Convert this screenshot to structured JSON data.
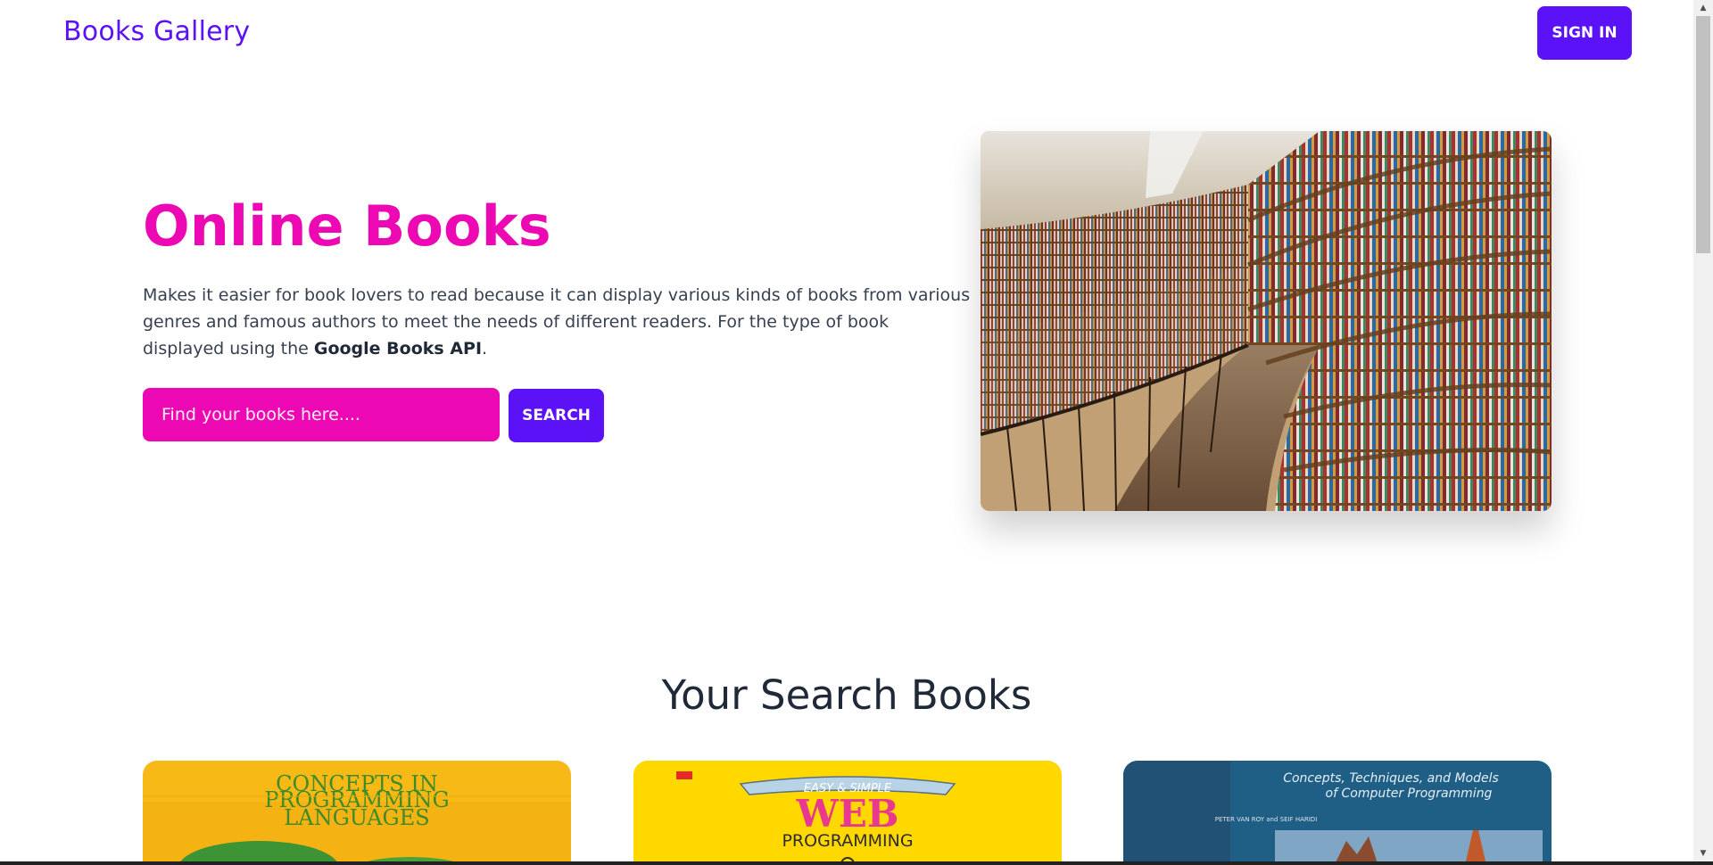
{
  "nav": {
    "brand": "Books Gallery",
    "signin_label": "SIGN IN"
  },
  "hero": {
    "title": "Online Books",
    "description_text": "Makes it easier for book lovers to read because it can display various kinds of books from various genres and famous authors to meet the needs of different readers. For the type of book displayed using the",
    "description_bold": "Google Books API",
    "description_end": ".",
    "search_placeholder": "Find your books here....",
    "search_button": "SEARCH"
  },
  "results": {
    "title": "Your Search Books",
    "cards": [
      {
        "cover_lines": [
          "CONCEPTS IN",
          "PROGRAMMING",
          "LANGUAGES"
        ]
      },
      {
        "cover_lines": [
          "EASY & SIMPLE",
          "WEB",
          "PROGRAMMING"
        ]
      },
      {
        "cover_lines": [
          "Concepts, Techniques, and Models",
          "of Computer Programming",
          "PETER VAN ROY and SEIF HARIDI"
        ]
      }
    ]
  },
  "colors": {
    "primary": "#5b12f6",
    "accent": "#ec09b4",
    "heading": "#1f2937",
    "body_text": "#374151"
  },
  "icons": {
    "scroll_up": "scroll-up-arrow-icon",
    "scroll_down": "scroll-down-arrow-icon"
  }
}
